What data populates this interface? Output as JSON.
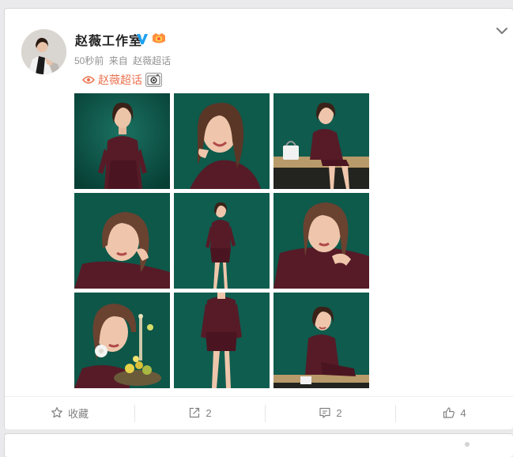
{
  "post": {
    "username": "赵薇工作室",
    "time": "50秒前",
    "source_prefix": "来自",
    "source": "赵薇超话",
    "topic": "赵薇超话",
    "photos": [
      {
        "scene": "standing-portrait"
      },
      {
        "scene": "smile-closeup"
      },
      {
        "scene": "seated-bench-bag"
      },
      {
        "scene": "lying-portrait"
      },
      {
        "scene": "full-body"
      },
      {
        "scene": "hand-on-shoulder"
      },
      {
        "scene": "flower-closeup"
      },
      {
        "scene": "full-body-front"
      },
      {
        "scene": "seated-bench"
      }
    ]
  },
  "actions": {
    "favorite_label": "收藏",
    "repost_count": "2",
    "comment_count": "2",
    "like_count": "4"
  },
  "colors": {
    "topic_accent": "#eb7350",
    "verified_blue": "#1da1f2",
    "photo_backdrop": "#0d5a4c",
    "outfit": "#5a1e2a"
  },
  "icons": {
    "verified": "verified-v-icon",
    "fan_badge": "fan-badge-icon",
    "topic": "topic-eye-icon",
    "camera": "camera-icon",
    "favorite": "star-icon",
    "repost": "repost-icon",
    "comment": "comment-icon",
    "like": "thumbs-up-icon",
    "expand": "chevron-down-icon"
  }
}
